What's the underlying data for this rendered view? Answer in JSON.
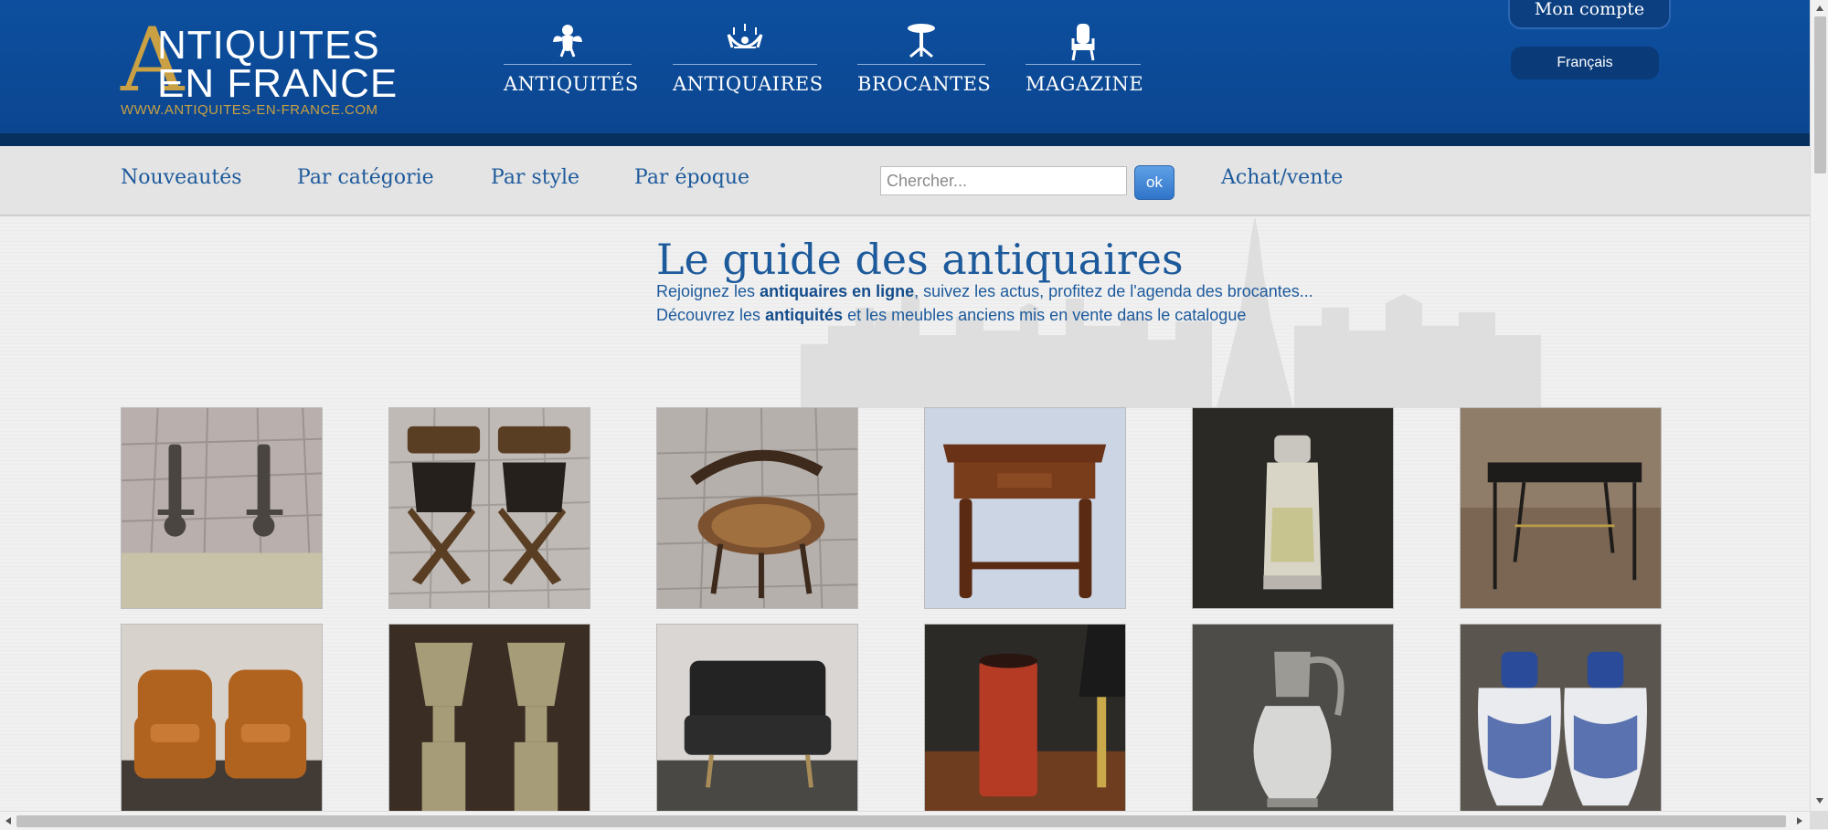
{
  "header": {
    "logo": {
      "big_letter": "A",
      "line1": "NTIQUITES",
      "line2": "EN FRANCE",
      "url": "WWW.ANTIQUITES-EN-FRANCE.COM"
    },
    "nav": [
      {
        "label": "ANTIQUITÉS",
        "icon": "cherub-icon"
      },
      {
        "label": "ANTIQUAIRES",
        "icon": "chandelier-icon"
      },
      {
        "label": "BROCANTES",
        "icon": "pedestal-table-icon"
      },
      {
        "label": "MAGAZINE",
        "icon": "armchair-icon"
      }
    ],
    "account_label": "Mon compte",
    "language_label": "Français"
  },
  "subnav": {
    "links": [
      "Nouveautés",
      "Par catégorie",
      "Par style",
      "Par époque"
    ],
    "search_placeholder": "Chercher...",
    "search_button": "ok",
    "buy_sell_label": "Achat/vente"
  },
  "main": {
    "title": "Le guide des antiquaires",
    "line1": {
      "pre": "Rejoignez les ",
      "bold": "antiquaires en ligne",
      "post": ", suivez les actus, profitez de l'agenda des brocantes..."
    },
    "line2": {
      "pre": "Découvrez les ",
      "bold": "antiquités",
      "post": " et les meubles anciens mis en vente dans le catalogue"
    }
  },
  "products": [
    {
      "name": "andirons",
      "subject": "pair of iron andirons on paving"
    },
    {
      "name": "dagobert-chairs",
      "subject": "pair of carved X-frame chairs"
    },
    {
      "name": "bentwood-chair",
      "subject": "bentwood office armchair"
    },
    {
      "name": "side-table",
      "subject": "walnut side table with drawer"
    },
    {
      "name": "silver-flask",
      "subject": "glass flask with silver mount"
    },
    {
      "name": "console-desk",
      "subject": "black metal console desk"
    },
    {
      "name": "club-armchairs",
      "subject": "pair of leather club armchairs"
    },
    {
      "name": "medici-vases",
      "subject": "pair of Medici urns on pedestals"
    },
    {
      "name": "leather-sofa",
      "subject": "black leather two-seat sofa"
    },
    {
      "name": "umbrella-stand",
      "subject": "red lacquered cylinder and lamp"
    },
    {
      "name": "crystal-ewer",
      "subject": "cut crystal ewer with silver mount"
    },
    {
      "name": "delft-jars",
      "subject": "pair of blue and white lidded jars"
    }
  ],
  "colors": {
    "header_blue": "#0d4f9e",
    "gold": "#c9a043",
    "link_blue": "#1d5a9c"
  }
}
